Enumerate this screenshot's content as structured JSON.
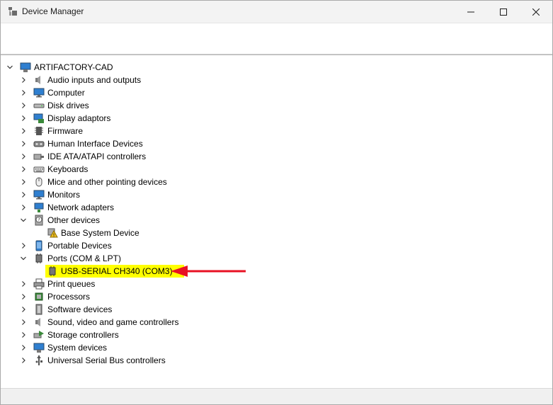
{
  "window": {
    "title": "Device Manager",
    "app_icon": "device-manager-icon",
    "buttons": [
      "minimize",
      "maximize",
      "close"
    ]
  },
  "tree": {
    "root": "ARTIFACTORY-CAD",
    "categories": [
      {
        "label": "Audio inputs and outputs",
        "icon": "speaker-icon",
        "expanded": false
      },
      {
        "label": "Computer",
        "icon": "monitor-icon",
        "expanded": false
      },
      {
        "label": "Disk drives",
        "icon": "disk-drive-icon",
        "expanded": false
      },
      {
        "label": "Display adaptors",
        "icon": "display-adapter-icon",
        "expanded": false
      },
      {
        "label": "Firmware",
        "icon": "chip-icon",
        "expanded": false
      },
      {
        "label": "Human Interface Devices",
        "icon": "hid-icon",
        "expanded": false
      },
      {
        "label": "IDE ATA/ATAPI controllers",
        "icon": "ide-controller-icon",
        "expanded": false
      },
      {
        "label": "Keyboards",
        "icon": "keyboard-icon",
        "expanded": false
      },
      {
        "label": "Mice and other pointing devices",
        "icon": "mouse-icon",
        "expanded": false
      },
      {
        "label": "Monitors",
        "icon": "monitor-icon",
        "expanded": false
      },
      {
        "label": "Network adapters",
        "icon": "network-icon",
        "expanded": false
      },
      {
        "label": "Other devices",
        "icon": "unknown-device-icon",
        "expanded": true,
        "children": [
          {
            "label": "Base System Device",
            "icon": "warning-device-icon"
          }
        ]
      },
      {
        "label": "Portable Devices",
        "icon": "portable-device-icon",
        "expanded": false
      },
      {
        "label": "Ports (COM & LPT)",
        "icon": "port-icon",
        "expanded": true,
        "children": [
          {
            "label": "USB-SERIAL CH340 (COM3)",
            "icon": "port-icon",
            "highlighted": true
          }
        ]
      },
      {
        "label": "Print queues",
        "icon": "printer-icon",
        "expanded": false
      },
      {
        "label": "Processors",
        "icon": "processor-icon",
        "expanded": false
      },
      {
        "label": "Software devices",
        "icon": "software-device-icon",
        "expanded": false
      },
      {
        "label": "Sound, video and game controllers",
        "icon": "speaker-icon",
        "expanded": false
      },
      {
        "label": "Storage controllers",
        "icon": "storage-controller-icon",
        "expanded": false
      },
      {
        "label": "System devices",
        "icon": "system-device-icon",
        "expanded": false
      },
      {
        "label": "Universal Serial Bus controllers",
        "icon": "usb-icon",
        "expanded": false
      }
    ]
  },
  "annotation": {
    "highlight_color": "#ffff00",
    "arrow_color": "#e81123"
  }
}
